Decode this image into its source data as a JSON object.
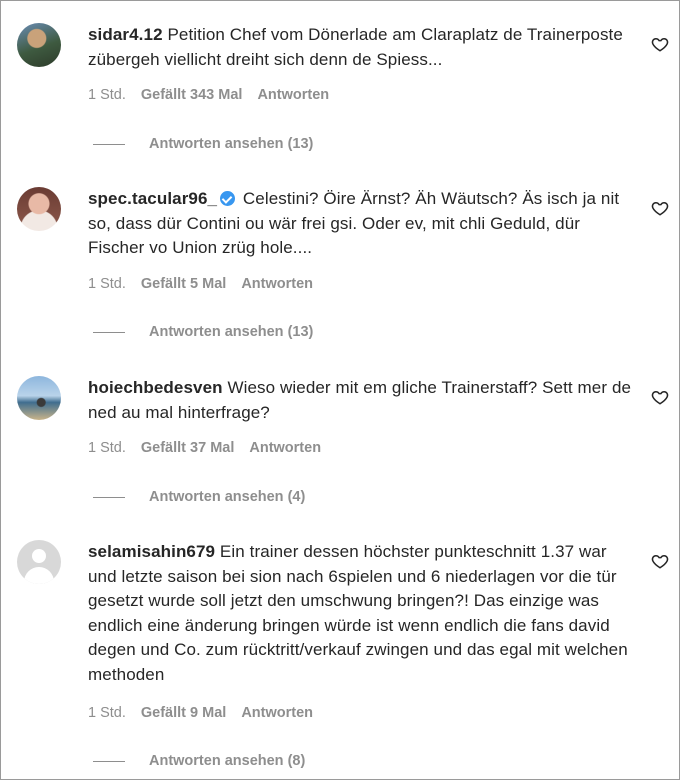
{
  "comments": [
    {
      "username": "sidar4.12",
      "verified": false,
      "text": "Petition Chef vom Dönerlade am Claraplatz de Trainerposte zübergeh viellicht dreiht sich denn de Spiess...",
      "time": "1 Std.",
      "likes": "Gefällt 343 Mal",
      "reply": "Antworten",
      "view_replies": "Antworten ansehen (13)"
    },
    {
      "username": "spec.tacular96_",
      "verified": true,
      "text": "Celestini? Öire Ärnst? Äh Wäutsch? Äs isch ja nit so, dass dür Contini ou wär frei gsi. Oder ev, mit chli Geduld, dür Fischer vo Union zrüg hole....",
      "time": "1 Std.",
      "likes": "Gefällt 5 Mal",
      "reply": "Antworten",
      "view_replies": "Antworten ansehen (13)"
    },
    {
      "username": "hoiechbedesven",
      "verified": false,
      "text": "Wieso wieder mit em gliche Trainerstaff? Sett mer de ned au mal hinterfrage?",
      "time": "1 Std.",
      "likes": "Gefällt 37 Mal",
      "reply": "Antworten",
      "view_replies": "Antworten ansehen (4)"
    },
    {
      "username": "selamisahin679",
      "verified": false,
      "text": "Ein trainer dessen höchster punkteschnitt 1.37 war und letzte saison bei sion nach 6spielen und 6 niederlagen vor die tür gesetzt wurde soll jetzt den umschwung bringen?! Das einzige was endlich eine änderung bringen würde ist wenn endlich die fans david degen und Co. zum rücktritt/verkauf zwingen und das egal mit welchen methoden",
      "time": "1 Std.",
      "likes": "Gefällt 9 Mal",
      "reply": "Antworten",
      "view_replies": "Antworten ansehen (8)"
    }
  ]
}
